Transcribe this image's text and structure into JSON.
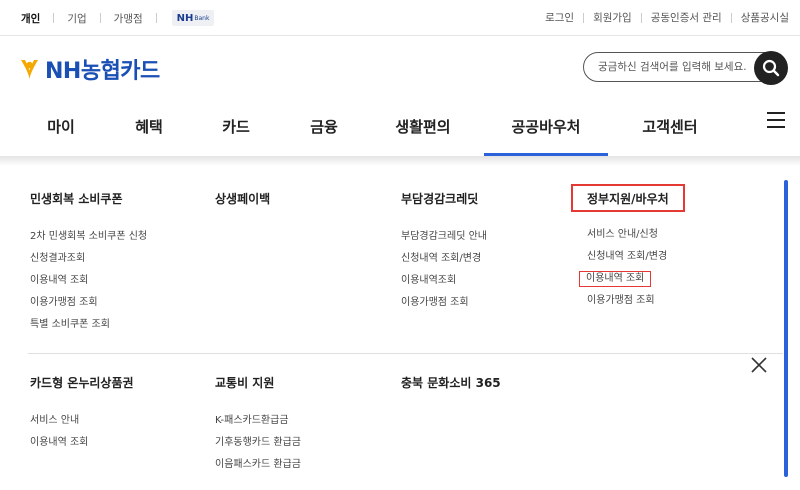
{
  "topbar": {
    "left": [
      {
        "label": "개인",
        "active": true
      },
      {
        "label": "기업",
        "active": false
      },
      {
        "label": "가맹점",
        "active": false
      }
    ],
    "nh_bank": {
      "main": "NH",
      "sub": "Bank"
    },
    "right": [
      "로그인",
      "회원가입",
      "공동인증서 관리",
      "상품공시실"
    ]
  },
  "header": {
    "logo_text": "NH농협카드",
    "search_placeholder": "궁금하신 검색어를 입력해 보세요."
  },
  "gnb": {
    "tabs": [
      {
        "label": "마이",
        "active": false
      },
      {
        "label": "혜택",
        "active": false
      },
      {
        "label": "카드",
        "active": false
      },
      {
        "label": "금융",
        "active": false
      },
      {
        "label": "생활편의",
        "active": false
      },
      {
        "label": "공공바우처",
        "active": true
      },
      {
        "label": "고객센터",
        "active": false
      }
    ]
  },
  "menu": {
    "row1": [
      {
        "title": "민생회복 소비쿠폰",
        "items": [
          "2차 민생회복 소비쿠폰 신청",
          "신청결과조회",
          "이용내역 조회",
          "이용가맹점 조회",
          "특별 소비쿠폰 조회"
        ]
      },
      {
        "title": "상생페이백",
        "items": []
      },
      {
        "title": "부담경감크레딧",
        "items": [
          "부담경감크레딧 안내",
          "신청내역 조회/변경",
          "이용내역조회",
          "이용가맹점 조회"
        ]
      },
      {
        "title": "정부지원/바우처",
        "items": [
          "서비스 안내/신청",
          "신청내역 조회/변경",
          "이용내역 조회",
          "이용가맹점 조회"
        ]
      }
    ],
    "row2": [
      {
        "title": "카드형 온누리상품권",
        "items": [
          "서비스 안내",
          "이용내역 조회"
        ]
      },
      {
        "title": "교통비 지원",
        "items": [
          "K-패스카드환급금",
          "기후동행카드 환급금",
          "이음패스카드 환급금"
        ]
      },
      {
        "title": "충북 문화소비 365",
        "items": []
      }
    ]
  },
  "colors": {
    "accent": "#2b62d9",
    "highlight": "#e53935",
    "logo": "#1a4fb5"
  }
}
